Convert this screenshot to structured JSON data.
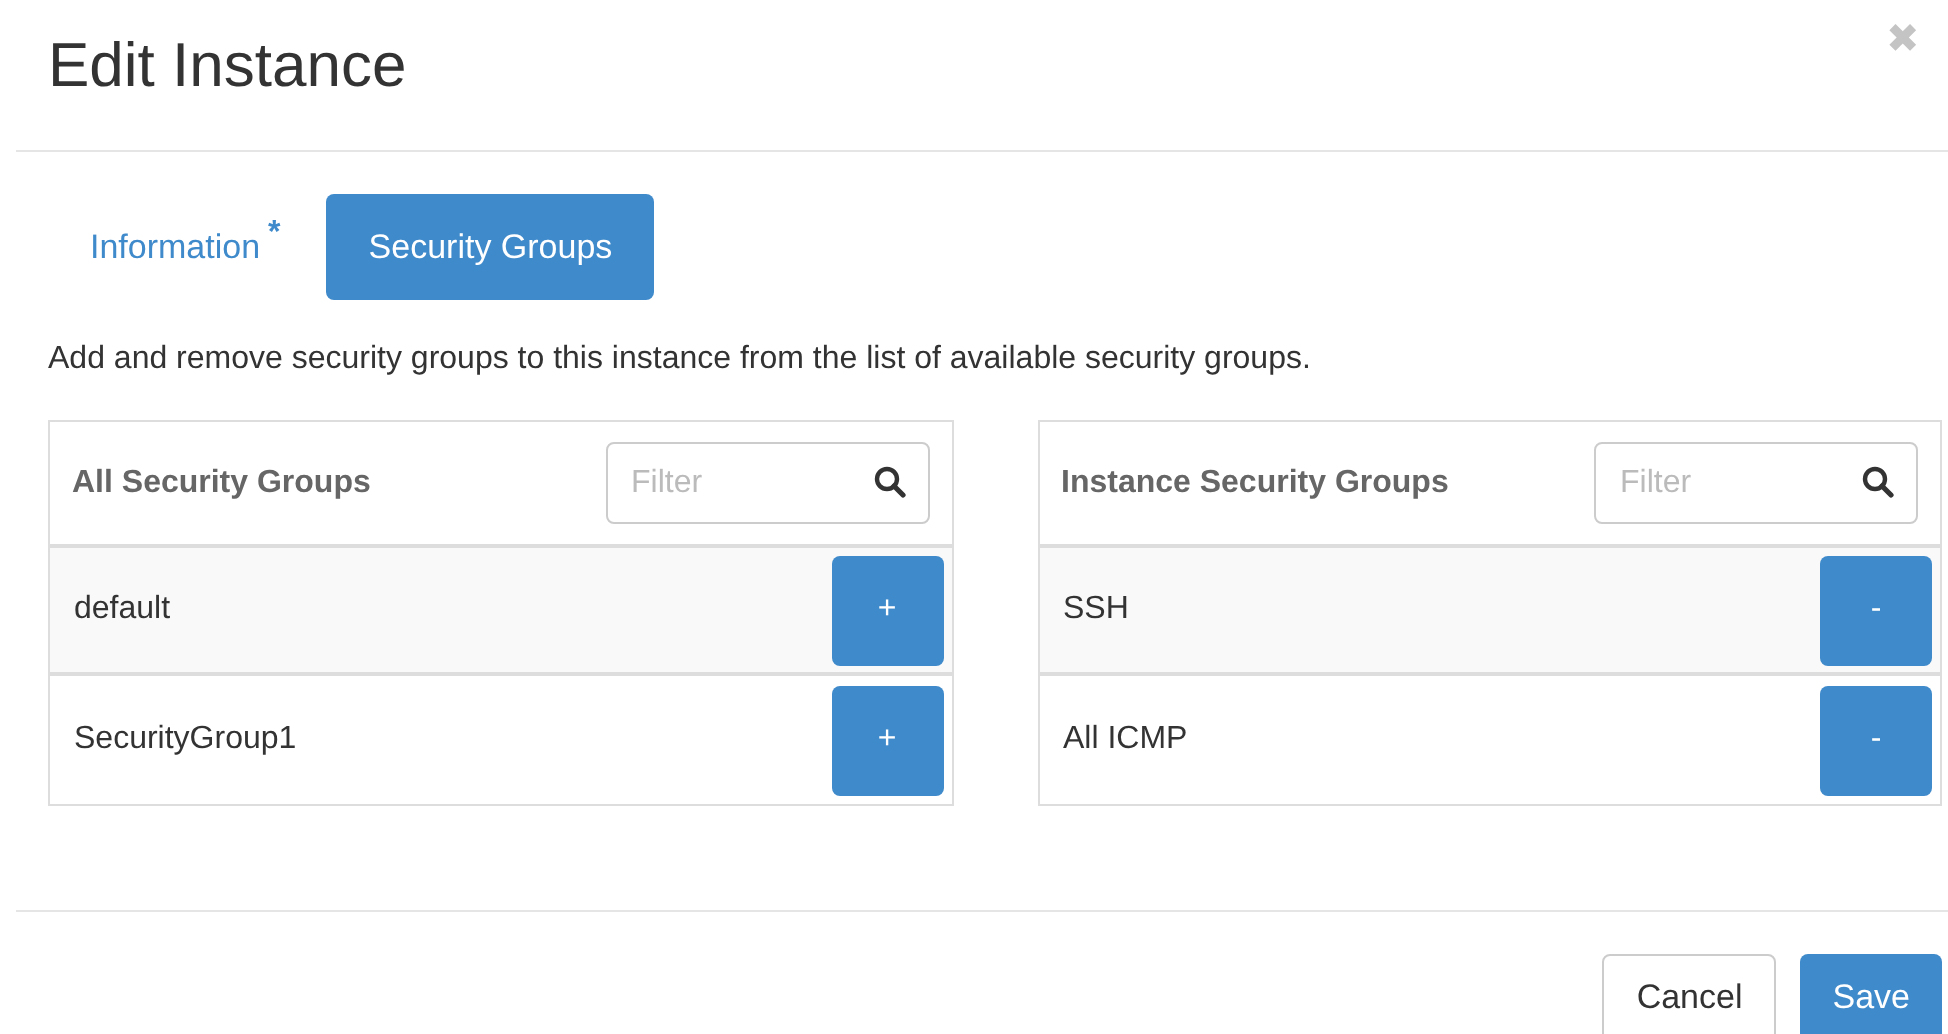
{
  "dialog": {
    "title": "Edit Instance",
    "close": "✖"
  },
  "tabs": [
    {
      "label": "Information",
      "marker": "*",
      "selected": false
    },
    {
      "label": "Security Groups",
      "selected": true
    }
  ],
  "description": "Add and remove security groups to this instance from the list of available security groups.",
  "lists": [
    {
      "heading": "All Security Groups",
      "filter": {
        "placeholder": "Filter"
      },
      "rows": [
        {
          "name": "default",
          "action": "+"
        },
        {
          "name": "SecurityGroup1",
          "action": "+"
        }
      ]
    },
    {
      "heading": "Instance Security Groups",
      "filter": {
        "placeholder": "Filter"
      },
      "rows": [
        {
          "name": "SSH",
          "action": "-"
        },
        {
          "name": "All ICMP",
          "action": "-"
        }
      ]
    }
  ],
  "buttons": [
    {
      "label": "Cancel",
      "kind": "secondary"
    },
    {
      "label": "Save",
      "kind": "primary"
    }
  ]
}
